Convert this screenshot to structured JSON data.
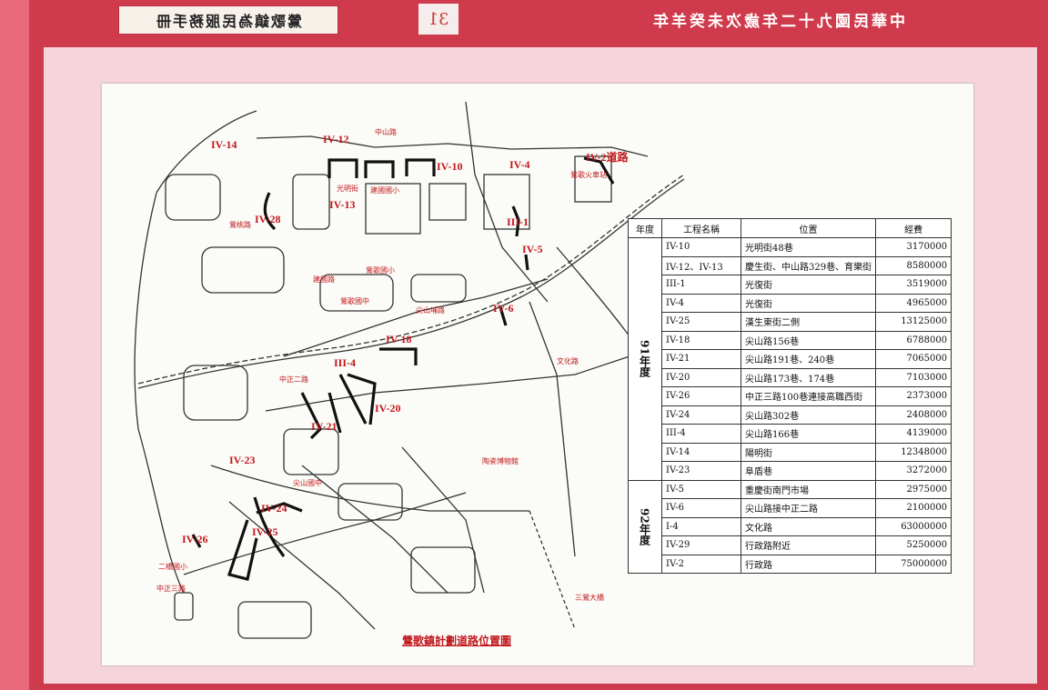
{
  "header": {
    "left_title": "鶯歌鎮為民服務手冊",
    "page_number": "31",
    "right_title": "中華民國九十二年歲次未癸羊年"
  },
  "map": {
    "title": "鶯歌鎮計劃道路位置圖",
    "project_labels": [
      "IV-14",
      "IV-12",
      "IV-10",
      "IV-4",
      "IV-2道路",
      "IV-28",
      "IV-13",
      "III-1",
      "IV-5",
      "IV-6",
      "IV-18",
      "III-4",
      "IV-20",
      "IV-21",
      "IV-23",
      "IV-24",
      "IV-25",
      "IV-26"
    ],
    "street_labels": [
      "中山路",
      "光明街",
      "建國國小",
      "鶯歌國小",
      "鶯歌國中",
      "中正二路",
      "尖山國中",
      "二橋國小",
      "中正三路",
      "尖山埔路",
      "陶瓷博物館",
      "文化路",
      "三鶯大橋",
      "鶯歌火車站",
      "鶯桃路",
      "建國路"
    ]
  },
  "table": {
    "headers": [
      "年度",
      "工程名稱",
      "位置",
      "經費"
    ],
    "groups": [
      {
        "year": "91年度",
        "rows": [
          {
            "name": "IV-10",
            "location": "光明街48巷",
            "cost": "3170000"
          },
          {
            "name": "IV-12、IV-13",
            "location": "慶生街、中山路329巷、育樂街",
            "cost": "8580000"
          },
          {
            "name": "III-1",
            "location": "光復街",
            "cost": "3519000"
          },
          {
            "name": "IV-4",
            "location": "光復街",
            "cost": "4965000"
          },
          {
            "name": "IV-25",
            "location": "漢生東街二側",
            "cost": "13125000"
          },
          {
            "name": "IV-18",
            "location": "尖山路156巷",
            "cost": "6788000"
          },
          {
            "name": "IV-21",
            "location": "尖山路191巷、240巷",
            "cost": "7065000"
          },
          {
            "name": "IV-20",
            "location": "尖山路173巷、174巷",
            "cost": "7103000"
          },
          {
            "name": "IV-26",
            "location": "中正三路100巷連接高職西街",
            "cost": "2373000"
          },
          {
            "name": "IV-24",
            "location": "尖山路302巷",
            "cost": "2408000"
          },
          {
            "name": "III-4",
            "location": "尖山路166巷",
            "cost": "4139000"
          },
          {
            "name": "IV-14",
            "location": "陽明街",
            "cost": "12348000"
          },
          {
            "name": "IV-23",
            "location": "阜盾巷",
            "cost": "3272000"
          }
        ]
      },
      {
        "year": "92年度",
        "rows": [
          {
            "name": "IV-5",
            "location": "重慶街南門市場",
            "cost": "2975000"
          },
          {
            "name": "IV-6",
            "location": "尖山路接中正二路",
            "cost": "2100000"
          },
          {
            "name": "I-4",
            "location": "文化路",
            "cost": "63000000"
          },
          {
            "name": "IV-29",
            "location": "行政路附近",
            "cost": "5250000"
          },
          {
            "name": "IV-2",
            "location": "行政路",
            "cost": "75000000"
          }
        ]
      }
    ]
  },
  "colors": {
    "band": "#cf3b4c",
    "panel": "#f6d4dc",
    "label": "#c2181c"
  }
}
